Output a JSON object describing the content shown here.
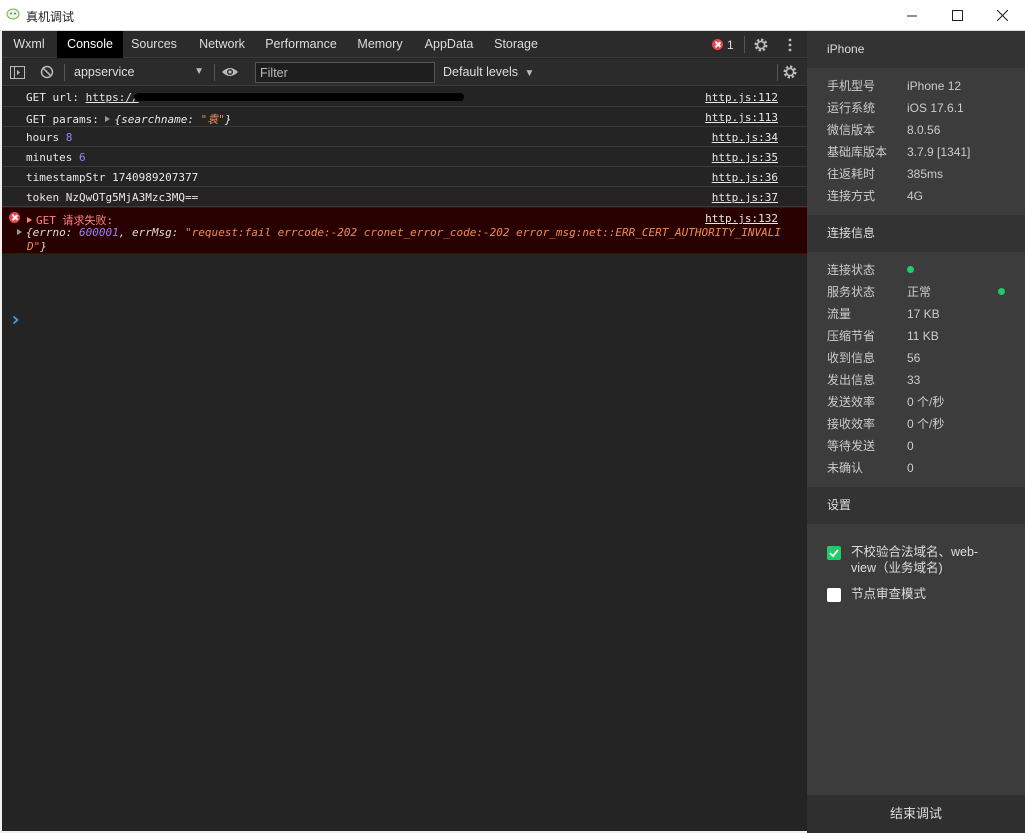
{
  "window": {
    "title": "真机调试",
    "icons": {
      "app": "wechat-devtools-icon",
      "minimize": "minimize-icon",
      "maximize": "maximize-icon",
      "close": "close-icon"
    }
  },
  "tabs": [
    {
      "label": "Wxml"
    },
    {
      "label": "Console"
    },
    {
      "label": "Sources"
    },
    {
      "label": "Network"
    },
    {
      "label": "Performance"
    },
    {
      "label": "Memory"
    },
    {
      "label": "AppData"
    },
    {
      "label": "Storage"
    }
  ],
  "active_tab": "Console",
  "error_count": "1",
  "toolbar": {
    "context": "appservice",
    "filter_placeholder": "Filter",
    "levels": "Default levels"
  },
  "console": {
    "rows": [
      {
        "label": "GET url:",
        "value": "https://",
        "source": "http.js:112"
      },
      {
        "label": "GET params:",
        "obj_open": "{searchname: ",
        "obj_val": "\"袁\"",
        "obj_close": "}",
        "source": "http.js:113"
      },
      {
        "label": "hours",
        "value": "8",
        "source": "http.js:34"
      },
      {
        "label": "minutes",
        "value": "6",
        "source": "http.js:35"
      },
      {
        "label": "timestampStr",
        "value": "1740989207377",
        "source": "http.js:36"
      },
      {
        "label": "token",
        "value": "NzQwOTg5MjA3Mzc3MQ==",
        "source": "http.js:37"
      }
    ],
    "error": {
      "title": "GET 请求失败:",
      "source": "http.js:132",
      "errno_key": "{errno: ",
      "errno_val": "600001",
      "errmsg_key": ", errMsg: ",
      "errmsg_val": "\"request:fail errcode:-202 cronet_error_code:-202 error_msg:net::ERR_CERT_AUTHORITY_INVALID\"",
      "close": "}"
    }
  },
  "panel": {
    "device_header": "iPhone",
    "device": [
      {
        "k": "手机型号",
        "v": "iPhone 12"
      },
      {
        "k": "运行系统",
        "v": "iOS 17.6.1"
      },
      {
        "k": "微信版本",
        "v": "8.0.56"
      },
      {
        "k": "基础库版本",
        "v": "3.7.9 [1341]"
      },
      {
        "k": "往返耗时",
        "v": "385ms"
      },
      {
        "k": "连接方式",
        "v": "4G"
      }
    ],
    "conn_header": "连接信息",
    "connection": [
      {
        "k": "连接状态",
        "v": ""
      },
      {
        "k": "服务状态",
        "v": "正常"
      },
      {
        "k": "流量",
        "v": "17 KB"
      },
      {
        "k": "压缩节省",
        "v": "11 KB"
      },
      {
        "k": "收到信息",
        "v": "56"
      },
      {
        "k": "发出信息",
        "v": "33"
      },
      {
        "k": "发送效率",
        "v": "0 个/秒"
      },
      {
        "k": "接收效率",
        "v": "0 个/秒"
      },
      {
        "k": "等待发送",
        "v": "0"
      },
      {
        "k": "未确认",
        "v": "0"
      }
    ],
    "settings_header": "设置",
    "settings": [
      {
        "label": "不校验合法域名、web-view（业务域名)",
        "checked": true
      },
      {
        "label": "节点审查模式",
        "checked": false
      }
    ],
    "end_button": "结束调试",
    "colors": {
      "status_green": "#1fcc6a",
      "error_red": "#e9454e"
    }
  }
}
